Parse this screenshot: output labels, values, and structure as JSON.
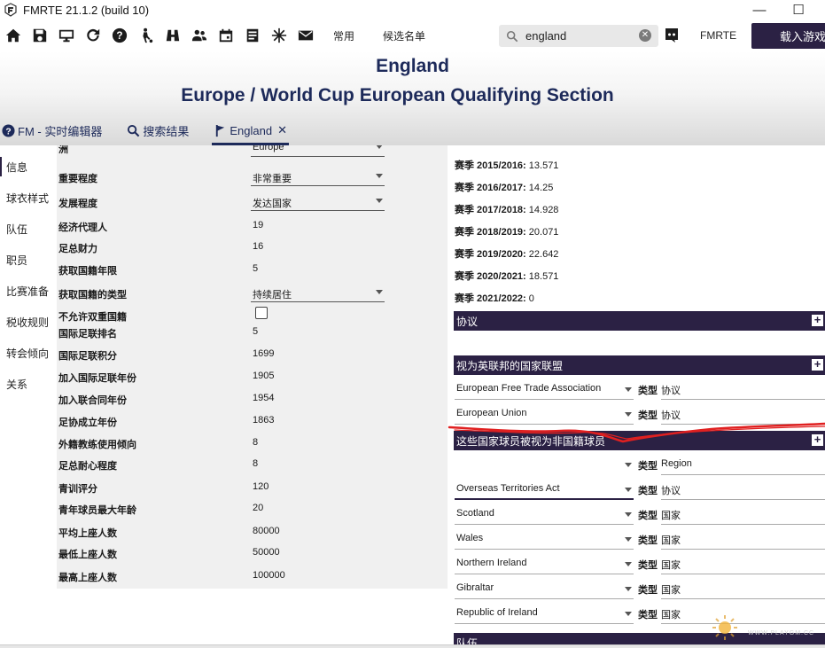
{
  "window": {
    "title": "FMRTE 21.1.2 (build 10)",
    "minimize": "—",
    "maximize": "☐"
  },
  "toolbar": {
    "icons": [
      "home-icon",
      "save-icon",
      "monitor-icon",
      "refresh-icon",
      "help-icon",
      "player-icon",
      "binoculars-icon",
      "people-icon",
      "calendar-icon",
      "list-icon",
      "settings-icon",
      "mail-icon"
    ],
    "common": "常用",
    "shortlist": "候选名单",
    "search_value": "england",
    "fmrte": "FMRTE",
    "load_game": "载入游戏"
  },
  "header": {
    "title": "England",
    "subtitle": "Europe / World Cup European Qualifying Section"
  },
  "tabs": [
    {
      "label": "FM - 实时编辑器"
    },
    {
      "label": "搜索结果"
    },
    {
      "label": "England"
    }
  ],
  "nav": [
    "信息",
    "球衣样式",
    "队伍",
    "职员",
    "比赛准备",
    "税收规则",
    "转会倾向",
    "关系"
  ],
  "fields": [
    {
      "label": "洲",
      "value": "Europe",
      "kind": "select"
    },
    {
      "label": "重要程度",
      "value": "非常重要",
      "kind": "select"
    },
    {
      "label": "发展程度",
      "value": "发达国家",
      "kind": "select"
    },
    {
      "label": "经济代理人",
      "value": "19",
      "kind": "text"
    },
    {
      "label": "足总财力",
      "value": "16",
      "kind": "text"
    },
    {
      "label": "获取国籍年限",
      "value": "5",
      "kind": "text"
    },
    {
      "label": "获取国籍的类型",
      "value": "持续居住",
      "kind": "select"
    },
    {
      "label": "不允许双重国籍",
      "value": "",
      "kind": "check"
    },
    {
      "label": "国际足联排名",
      "value": "5",
      "kind": "text"
    },
    {
      "label": "国际足联积分",
      "value": "1699",
      "kind": "text"
    },
    {
      "label": "加入国际足联年份",
      "value": "1905",
      "kind": "text"
    },
    {
      "label": "加入联合同年份",
      "value": "1954",
      "kind": "text"
    },
    {
      "label": "足协成立年份",
      "value": "1863",
      "kind": "text"
    },
    {
      "label": "外籍教练使用倾向",
      "value": "8",
      "kind": "text"
    },
    {
      "label": "足总耐心程度",
      "value": "8",
      "kind": "text"
    },
    {
      "label": "青训评分",
      "value": "120",
      "kind": "text"
    },
    {
      "label": "青年球员最大年龄",
      "value": "20",
      "kind": "text"
    },
    {
      "label": "平均上座人数",
      "value": "80000",
      "kind": "text"
    },
    {
      "label": "最低上座人数",
      "value": "50000",
      "kind": "text"
    },
    {
      "label": "最高上座人数",
      "value": "100000",
      "kind": "text"
    }
  ],
  "seasons": [
    {
      "label": "赛季 2015/2016:",
      "value": "13.571"
    },
    {
      "label": "赛季 2016/2017:",
      "value": "14.25"
    },
    {
      "label": "赛季 2017/2018:",
      "value": "14.928"
    },
    {
      "label": "赛季 2018/2019:",
      "value": "20.071"
    },
    {
      "label": "赛季 2019/2020:",
      "value": "22.642"
    },
    {
      "label": "赛季 2020/2021:",
      "value": "18.571"
    },
    {
      "label": "赛季 2021/2022:",
      "value": "0"
    }
  ],
  "sections": {
    "agreements": "协议",
    "federations": "视为英联邦的国家联盟",
    "non_foreign": "这些国家球员被视为非国籍球员",
    "squad": "队伍"
  },
  "type_label": "类型",
  "federation_rows": [
    {
      "name": "European Free Trade Association",
      "type": "协议"
    },
    {
      "name": "European Union",
      "type": "协议"
    }
  ],
  "nonforeign_rows": [
    {
      "name": "",
      "type": "Region"
    },
    {
      "name": "Overseas Territories Act",
      "type": "协议"
    },
    {
      "name": "Scotland",
      "type": "国家"
    },
    {
      "name": "Wales",
      "type": "国家"
    },
    {
      "name": "Northern Ireland",
      "type": "国家"
    },
    {
      "name": "Gibraltar",
      "type": "国家"
    },
    {
      "name": "Republic of Ireland",
      "type": "国家"
    }
  ],
  "watermark": "WWW.PLAYGM.CC",
  "colors": {
    "accent": "#2b2144",
    "title": "#1d2a5a",
    "annotation": "#e02020"
  }
}
